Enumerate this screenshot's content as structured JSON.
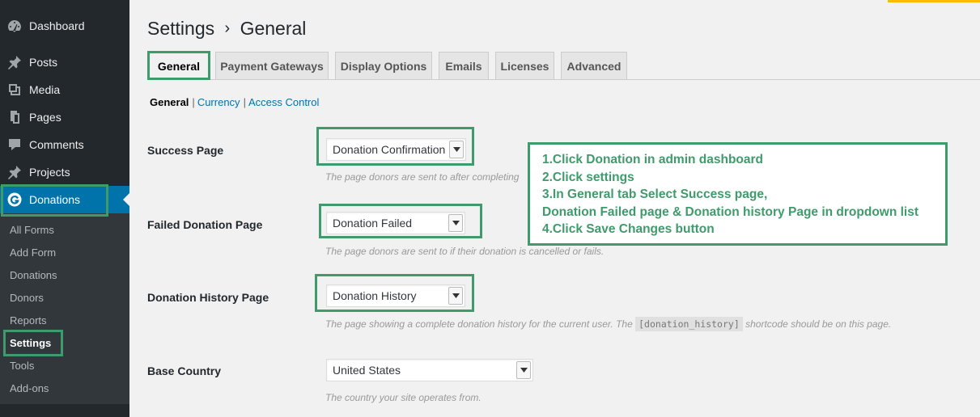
{
  "sidebar": {
    "menu": [
      {
        "label": "Dashboard",
        "icon": "dashboard-icon"
      },
      {
        "label": "Posts",
        "icon": "pushpin-icon"
      },
      {
        "label": "Media",
        "icon": "media-icon"
      },
      {
        "label": "Pages",
        "icon": "pages-icon"
      },
      {
        "label": "Comments",
        "icon": "comments-icon"
      },
      {
        "label": "Projects",
        "icon": "pushpin-icon"
      },
      {
        "label": "Donations",
        "icon": "give-logo-icon"
      }
    ],
    "submenu": [
      "All Forms",
      "Add Form",
      "Donations",
      "Donors",
      "Reports",
      "Settings",
      "Tools",
      "Add-ons"
    ]
  },
  "header": {
    "title": "Settings",
    "separator": "›",
    "subtitle": "General"
  },
  "tabs": [
    "General",
    "Payment Gateways",
    "Display Options",
    "Emails",
    "Licenses",
    "Advanced"
  ],
  "subnav": {
    "current": "General",
    "links": [
      "Currency",
      "Access Control"
    ],
    "separator": "|"
  },
  "fields": {
    "success": {
      "label": "Success Page",
      "value": "Donation Confirmation",
      "description": "The page donors are sent to after completing"
    },
    "failed": {
      "label": "Failed Donation Page",
      "value": "Donation Failed",
      "description": "The page donors are sent to if their donation is cancelled or fails."
    },
    "history": {
      "label": "Donation History Page",
      "value": "Donation History",
      "description_before": "The page showing a complete donation history for the current user. The",
      "shortcode": "[donation_history]",
      "description_after": "shortcode should be on this page."
    },
    "country": {
      "label": "Base Country",
      "value": "United States",
      "description": "The country your site operates from."
    }
  },
  "instructions": [
    "1.Click Donation in admin dashboard",
    "2.Click settings",
    "3.In General tab Select Success page,",
    "Donation Failed page & Donation history Page in dropdown list",
    "4.Click Save Changes button"
  ],
  "colors": {
    "sidebar_bg": "#23282d",
    "submenu_bg": "#32373c",
    "active_blue": "#0073aa",
    "highlight_green": "#3f9b6b",
    "top_accent": "#ffb900"
  }
}
